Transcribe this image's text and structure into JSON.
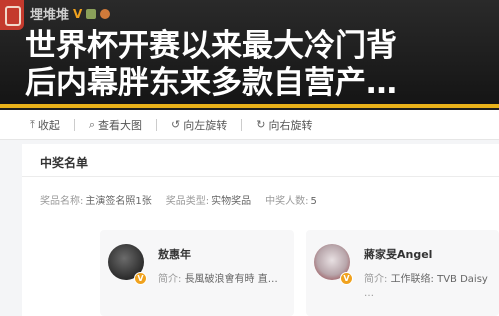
{
  "header": {
    "account_name": "埋堆堆",
    "verified_badge": "V",
    "headline_line1": "世界杯开赛以来最大冷门背",
    "headline_line2": "后内幕胖东来多款自营产…",
    "colors": {
      "accent_bar": "#e9b21a",
      "banner_bg": "#1e1e1e"
    }
  },
  "toolbar": {
    "items": [
      {
        "label": "收起",
        "icon": "collapse-icon"
      },
      {
        "label": "查看大图",
        "icon": "zoom-icon"
      },
      {
        "label": "向左旋转",
        "icon": "rotate-left-icon"
      },
      {
        "label": "向右旋转",
        "icon": "rotate-right-icon"
      }
    ]
  },
  "card": {
    "title": "中奖名单",
    "meta": [
      {
        "label": "奖品名称:",
        "value": "主演签名照1张"
      },
      {
        "label": "奖品类型:",
        "value": "实物奖品"
      },
      {
        "label": "中奖人数:",
        "value": "5"
      }
    ],
    "winners": [
      {
        "name": "敖惠年",
        "bio_label": "简介:",
        "bio": "長風破浪會有時 直…"
      },
      {
        "name": "蔣家旻Angel",
        "bio_label": "简介:",
        "bio": "工作联络: TVB Daisy",
        "more": "…"
      }
    ]
  }
}
